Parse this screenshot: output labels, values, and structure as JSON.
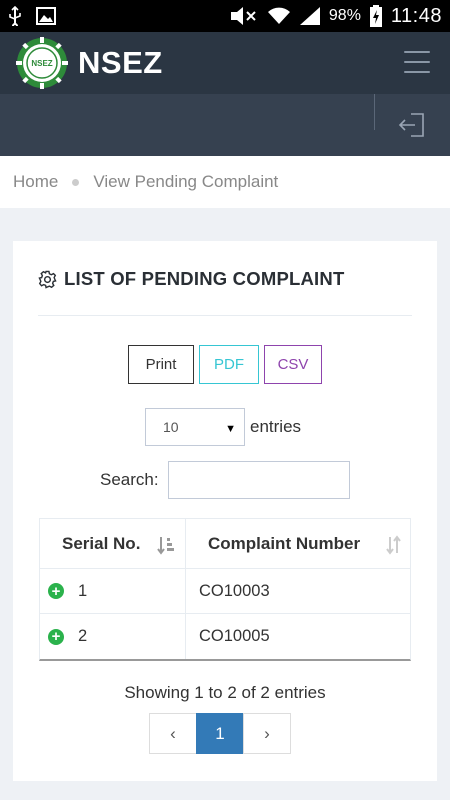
{
  "status_bar": {
    "battery": "98%",
    "time": "11:48"
  },
  "header": {
    "app_title": "NSEZ",
    "logo_text": "NSEZ"
  },
  "breadcrumb": {
    "home": "Home",
    "current": "View Pending Complaint"
  },
  "card": {
    "title": "LIST OF PENDING COMPLAINT",
    "buttons": {
      "print": "Print",
      "pdf": "PDF",
      "csv": "CSV"
    },
    "length": {
      "selected": "10",
      "suffix": "entries"
    },
    "search": {
      "label": "Search:",
      "value": ""
    },
    "table": {
      "columns": [
        "Serial No.",
        "Complaint Number"
      ],
      "rows": [
        {
          "serial": "1",
          "complaint": "CO10003"
        },
        {
          "serial": "2",
          "complaint": "CO10005"
        }
      ]
    },
    "info": "Showing 1 to 2 of 2 entries",
    "pagination": {
      "prev": "‹",
      "current": "1",
      "next": "›"
    }
  },
  "colors": {
    "header_bg": "#2b3643",
    "subheader_bg": "#364150",
    "pdf": "#36c6d3",
    "csv": "#8e44ad",
    "active_page": "#337ab7",
    "expand": "#2bb24c"
  }
}
